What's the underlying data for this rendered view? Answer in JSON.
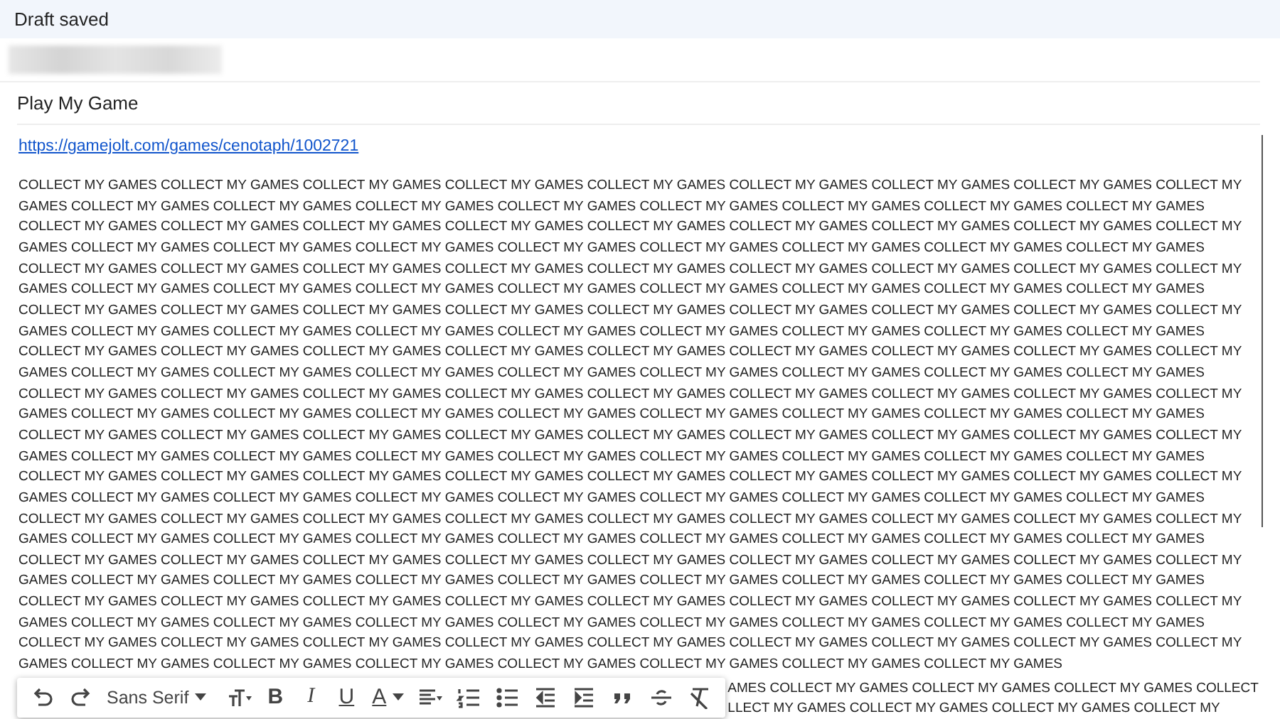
{
  "header": {
    "status": "Draft saved"
  },
  "recipients": {
    "redacted": true
  },
  "subject": "Play My Game",
  "body": {
    "link": "https://gamejolt.com/games/cenotaph/1002721",
    "text": "COLLECT MY GAMES COLLECT MY GAMES COLLECT MY GAMES COLLECT MY GAMES COLLECT MY GAMES COLLECT MY GAMES COLLECT MY GAMES COLLECT MY GAMES COLLECT MY GAMES COLLECT MY GAMES COLLECT MY GAMES COLLECT MY GAMES COLLECT MY GAMES COLLECT MY GAMES COLLECT MY GAMES COLLECT MY GAMES COLLECT MY GAMES COLLECT MY GAMES COLLECT MY GAMES COLLECT MY GAMES COLLECT MY GAMES COLLECT MY GAMES COLLECT MY GAMES COLLECT MY GAMES COLLECT MY GAMES COLLECT MY GAMES COLLECT MY GAMES COLLECT MY GAMES COLLECT MY GAMES COLLECT MY GAMES COLLECT MY GAMES COLLECT MY GAMES COLLECT MY GAMES COLLECT MY GAMES COLLECT MY GAMES COLLECT MY GAMES COLLECT MY GAMES COLLECT MY GAMES COLLECT MY GAMES COLLECT MY GAMES COLLECT MY GAMES COLLECT MY GAMES COLLECT MY GAMES COLLECT MY GAMES COLLECT MY GAMES COLLECT MY GAMES COLLECT MY GAMES COLLECT MY GAMES COLLECT MY GAMES COLLECT MY GAMES COLLECT MY GAMES COLLECT MY GAMES COLLECT MY GAMES COLLECT MY GAMES COLLECT MY GAMES COLLECT MY GAMES COLLECT MY GAMES COLLECT MY GAMES COLLECT MY GAMES COLLECT MY GAMES COLLECT MY GAMES COLLECT MY GAMES COLLECT MY GAMES COLLECT MY GAMES COLLECT MY GAMES COLLECT MY GAMES COLLECT MY GAMES COLLECT MY GAMES COLLECT MY GAMES COLLECT MY GAMES COLLECT MY GAMES COLLECT MY GAMES COLLECT MY GAMES COLLECT MY GAMES COLLECT MY GAMES COLLECT MY GAMES COLLECT MY GAMES COLLECT MY GAMES COLLECT MY GAMES COLLECT MY GAMES COLLECT MY GAMES COLLECT MY GAMES COLLECT MY GAMES COLLECT MY GAMES COLLECT MY GAMES COLLECT MY GAMES COLLECT MY GAMES COLLECT MY GAMES COLLECT MY GAMES COLLECT MY GAMES COLLECT MY GAMES COLLECT MY GAMES COLLECT MY GAMES COLLECT MY GAMES COLLECT MY GAMES COLLECT MY GAMES COLLECT MY GAMES COLLECT MY GAMES COLLECT MY GAMES COLLECT MY GAMES COLLECT MY GAMES COLLECT MY GAMES COLLECT MY GAMES COLLECT MY GAMES COLLECT MY GAMES COLLECT MY GAMES COLLECT MY GAMES COLLECT MY GAMES COLLECT MY GAMES COLLECT MY GAMES COLLECT MY GAMES COLLECT MY GAMES COLLECT MY GAMES COLLECT MY GAMES COLLECT MY GAMES COLLECT MY GAMES COLLECT MY GAMES COLLECT MY GAMES COLLECT MY GAMES COLLECT MY GAMES COLLECT MY GAMES COLLECT MY GAMES COLLECT MY GAMES COLLECT MY GAMES COLLECT MY GAMES COLLECT MY GAMES COLLECT MY GAMES COLLECT MY GAMES COLLECT MY GAMES COLLECT MY GAMES COLLECT MY GAMES COLLECT MY GAMES COLLECT MY GAMES COLLECT MY GAMES COLLECT MY GAMES COLLECT MY GAMES COLLECT MY GAMES COLLECT MY GAMES COLLECT MY GAMES COLLECT MY GAMES COLLECT MY GAMES COLLECT MY GAMES COLLECT MY GAMES COLLECT MY GAMES COLLECT MY GAMES COLLECT MY GAMES COLLECT MY GAMES COLLECT MY GAMES COLLECT MY GAMES COLLECT MY GAMES COLLECT MY GAMES COLLECT MY GAMES COLLECT MY GAMES COLLECT MY GAMES COLLECT MY GAMES COLLECT MY GAMES COLLECT MY GAMES COLLECT MY GAMES COLLECT MY GAMES COLLECT MY GAMES COLLECT MY GAMES COLLECT MY GAMES COLLECT MY GAMES COLLECT MY GAMES COLLECT MY GAMES COLLECT MY GAMES COLLECT MY GAMES COLLECT MY GAMES COLLECT MY GAMES COLLECT MY GAMES COLLECT MY GAMES COLLECT MY GAMES COLLECT MY GAMES COLLECT MY GAMES COLLECT MY GAMES COLLECT MY GAMES COLLECT MY GAMES COLLECT MY GAMES COLLECT MY GAMES COLLECT MY GAMES COLLECT MY GAMES COLLECT MY GAMES COLLECT MY GAMES COLLECT MY GAMES COLLECT MY GAMES COLLECT MY GAMES COLLECT MY GAMES COLLECT MY GAMES COLLECT MY GAMES COLLECT MY GAMES COLLECT MY GAMES COLLECT MY GAMES COLLECT MY GAMES COLLECT MY GAMES COLLECT MY GAMES COLLECT MY GAMES COLLECT MY GAMES COLLECT MY GAMES COLLECT MY GAMES COLLECT MY GAMES COLLECT MY GAMES COLLECT MY GAMES COLLECT MY GAMES",
    "tail_lines": [
      "AMES COLLECT MY GAMES COLLECT MY GAMES COLLECT MY GAMES COLLECT",
      "LLECT MY GAMES COLLECT MY GAMES COLLECT MY GAMES COLLECT MY"
    ]
  },
  "toolbar": {
    "font": "Sans Serif",
    "buttons": [
      {
        "kind": "undo"
      },
      {
        "kind": "redo"
      },
      {
        "kind": "font"
      },
      {
        "kind": "size"
      },
      {
        "kind": "bold",
        "glyph": "B"
      },
      {
        "kind": "italic",
        "glyph": "I"
      },
      {
        "kind": "underline",
        "glyph": "U"
      },
      {
        "kind": "color",
        "glyph": "A"
      },
      {
        "kind": "align"
      },
      {
        "kind": "numbered"
      },
      {
        "kind": "bulleted"
      },
      {
        "kind": "outdent"
      },
      {
        "kind": "indent"
      },
      {
        "kind": "quote"
      },
      {
        "kind": "strike"
      },
      {
        "kind": "clear"
      }
    ]
  }
}
